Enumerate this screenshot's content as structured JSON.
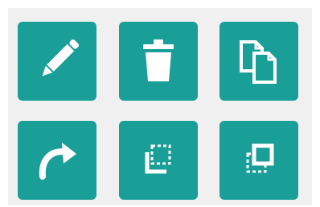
{
  "toolbar": {
    "background": "#f0f0f0",
    "button_color": "#1a9e98",
    "icon_color": "#ffffff",
    "buttons": [
      {
        "icon": "pencil-icon",
        "action": "edit"
      },
      {
        "icon": "trash-icon",
        "action": "delete"
      },
      {
        "icon": "copy-icon",
        "action": "duplicate"
      },
      {
        "icon": "redo-icon",
        "action": "redo"
      },
      {
        "icon": "send-to-back-icon",
        "action": "send-backward"
      },
      {
        "icon": "bring-to-front-icon",
        "action": "bring-forward"
      }
    ]
  }
}
